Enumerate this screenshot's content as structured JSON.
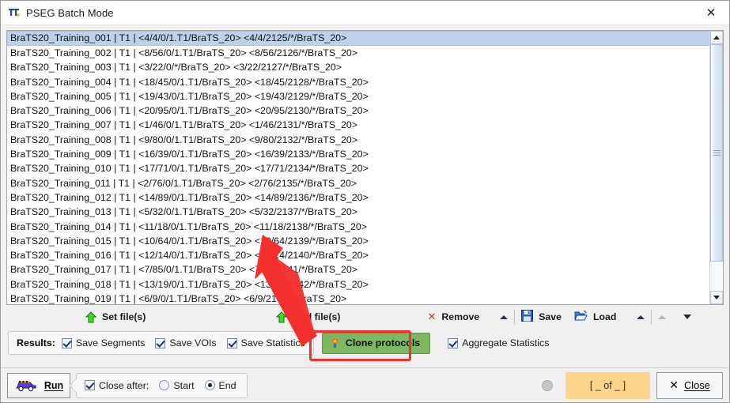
{
  "window": {
    "title": "PSEG Batch Mode",
    "icon": "pseg-app-icon",
    "close_icon": "✕"
  },
  "list": {
    "items": [
      "BraTS20_Training_001 | T1 |  <4/4/0/1.T1/BraTS_20> <4/4/2125/*/BraTS_20>",
      "BraTS20_Training_002 | T1 |  <8/56/0/1.T1/BraTS_20> <8/56/2126/*/BraTS_20>",
      "BraTS20_Training_003 | T1 |  <3/22/0/*/BraTS_20> <3/22/2127/*/BraTS_20>",
      "BraTS20_Training_004 | T1 |  <18/45/0/1.T1/BraTS_20> <18/45/2128/*/BraTS_20>",
      "BraTS20_Training_005 | T1 |  <19/43/0/1.T1/BraTS_20> <19/43/2129/*/BraTS_20>",
      "BraTS20_Training_006 | T1 |  <20/95/0/1.T1/BraTS_20> <20/95/2130/*/BraTS_20>",
      "BraTS20_Training_007 | T1 |  <1/46/0/1.T1/BraTS_20> <1/46/2131/*/BraTS_20>",
      "BraTS20_Training_008 | T1 |  <9/80/0/1.T1/BraTS_20> <9/80/2132/*/BraTS_20>",
      "BraTS20_Training_009 | T1 |  <16/39/0/1.T1/BraTS_20> <16/39/2133/*/BraTS_20>",
      "BraTS20_Training_010 | T1 |  <17/71/0/1.T1/BraTS_20> <17/71/2134/*/BraTS_20>",
      "BraTS20_Training_011 | T1 |  <2/76/0/1.T1/BraTS_20> <2/76/2135/*/BraTS_20>",
      "BraTS20_Training_012 | T1 |  <14/89/0/1.T1/BraTS_20> <14/89/2136/*/BraTS_20>",
      "BraTS20_Training_013 | T1 |  <5/32/0/1.T1/BraTS_20> <5/32/2137/*/BraTS_20>",
      "BraTS20_Training_014 | T1 |  <11/18/0/1.T1/BraTS_20> <11/18/2138/*/BraTS_20>",
      "BraTS20_Training_015 | T1 |  <10/64/0/1.T1/BraTS_20> <10/64/2139/*/BraTS_20>",
      "BraTS20_Training_016 | T1 |  <12/14/0/1.T1/BraTS_20> <12/14/2140/*/BraTS_20>",
      "BraTS20_Training_017 | T1 |  <7/85/0/1.T1/BraTS_20> <7/85/2141/*/BraTS_20>",
      "BraTS20_Training_018 | T1 |  <13/19/0/1.T1/BraTS_20> <13/19/2142/*/BraTS_20>",
      "BraTS20_Training_019 | T1 |  <6/9/0/1.T1/BraTS_20> <6/9/2143/*/BraTS_20>"
    ],
    "selected_index": 0,
    "scrollbar": {
      "up_icon": "scroll-up-icon",
      "down_icon": "scroll-down-icon"
    }
  },
  "toolbar": {
    "set_files_label": "Set file(s)",
    "set_files_icon": "green-up-arrow-icon",
    "add_files_label": "Add file(s)",
    "add_files_icon": "green-up-arrow-icon",
    "remove_label": "Remove",
    "remove_icon": "red-x-icon",
    "save_label": "Save",
    "save_icon": "floppy-disk-icon",
    "load_label": "Load",
    "load_icon": "open-folder-icon"
  },
  "results": {
    "label": "Results:",
    "checkboxes": [
      {
        "label": "Save Segments",
        "checked": true
      },
      {
        "label": "Save VOIs",
        "checked": true
      },
      {
        "label": "Save Statistics",
        "checked": true
      }
    ],
    "clone_button": {
      "label": "Clone protocols",
      "icon": "starburst-icon",
      "color": "#7cb861",
      "highlight_color": "#f3302e",
      "highlighted": true
    },
    "aggregate": {
      "label": "Aggregate Statistics",
      "checked": true
    }
  },
  "bottom": {
    "run_label": "Run",
    "run_icon": "car-icon",
    "close_after_label": "Close after:",
    "close_after_checked": true,
    "radios": [
      {
        "label": "Start",
        "selected": false
      },
      {
        "label": "End",
        "selected": true
      }
    ],
    "status_dot_icon": "status-dot-icon",
    "progress_text": "[ _ of _ ]",
    "progress_color": "#fcd48b",
    "close_label": "Close",
    "close_icon": "✕"
  },
  "annotation": {
    "arrow_color": "#f3302e",
    "arrow_icon": "pointer-arrow-annotation"
  }
}
